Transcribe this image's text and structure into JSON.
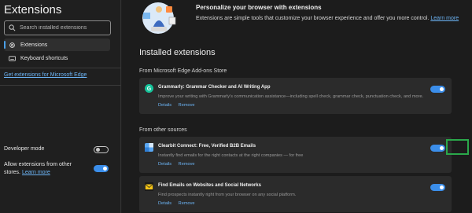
{
  "sidebar": {
    "title": "Extensions",
    "search_placeholder": "Search installed extensions",
    "nav": [
      {
        "label": "Extensions",
        "icon": "gear-icon",
        "active": true
      },
      {
        "label": "Keyboard shortcuts",
        "icon": "keyboard-icon",
        "active": false
      }
    ],
    "get_extensions_link": "Get extensions for Microsoft Edge",
    "developer_mode": {
      "label": "Developer mode",
      "enabled": false
    },
    "allow_other_stores": {
      "label": "Allow extensions from other stores.",
      "link": "Learn more",
      "enabled": true
    }
  },
  "main": {
    "hero": {
      "title": "Personalize your browser with extensions",
      "description": "Extensions are simple tools that customize your browser experience and offer you more control.",
      "link": "Learn more"
    },
    "installed_heading": "Installed extensions",
    "sections": [
      {
        "label": "From Microsoft Edge Add-ons Store",
        "items": [
          {
            "name": "Grammarly: Grammar Checker and AI Writing App",
            "description": "Improve your writing with Grammarly's communication assistance—including spell check, grammar check, punctuation check, and more.",
            "details": "Details",
            "remove": "Remove",
            "enabled": true,
            "icon": "grammarly-icon"
          }
        ]
      },
      {
        "label": "From other sources",
        "items": [
          {
            "name": "Clearbit Connect: Free, Verified B2B Emails",
            "description": "Instantly find emails for the right contacts at the right companies — for free",
            "details": "Details",
            "remove": "Remove",
            "enabled": true,
            "icon": "clearbit-icon"
          },
          {
            "name": "Find Emails on Websites and Social Networks",
            "description": "Find prospects instantly right from your browser on any social platform.",
            "details": "Details",
            "remove": "Remove",
            "enabled": true,
            "icon": "envelope-icon"
          }
        ]
      }
    ]
  },
  "colors": {
    "accent": "#3b8eea",
    "highlight": "#2aa84a",
    "link": "#6cb4f5"
  }
}
